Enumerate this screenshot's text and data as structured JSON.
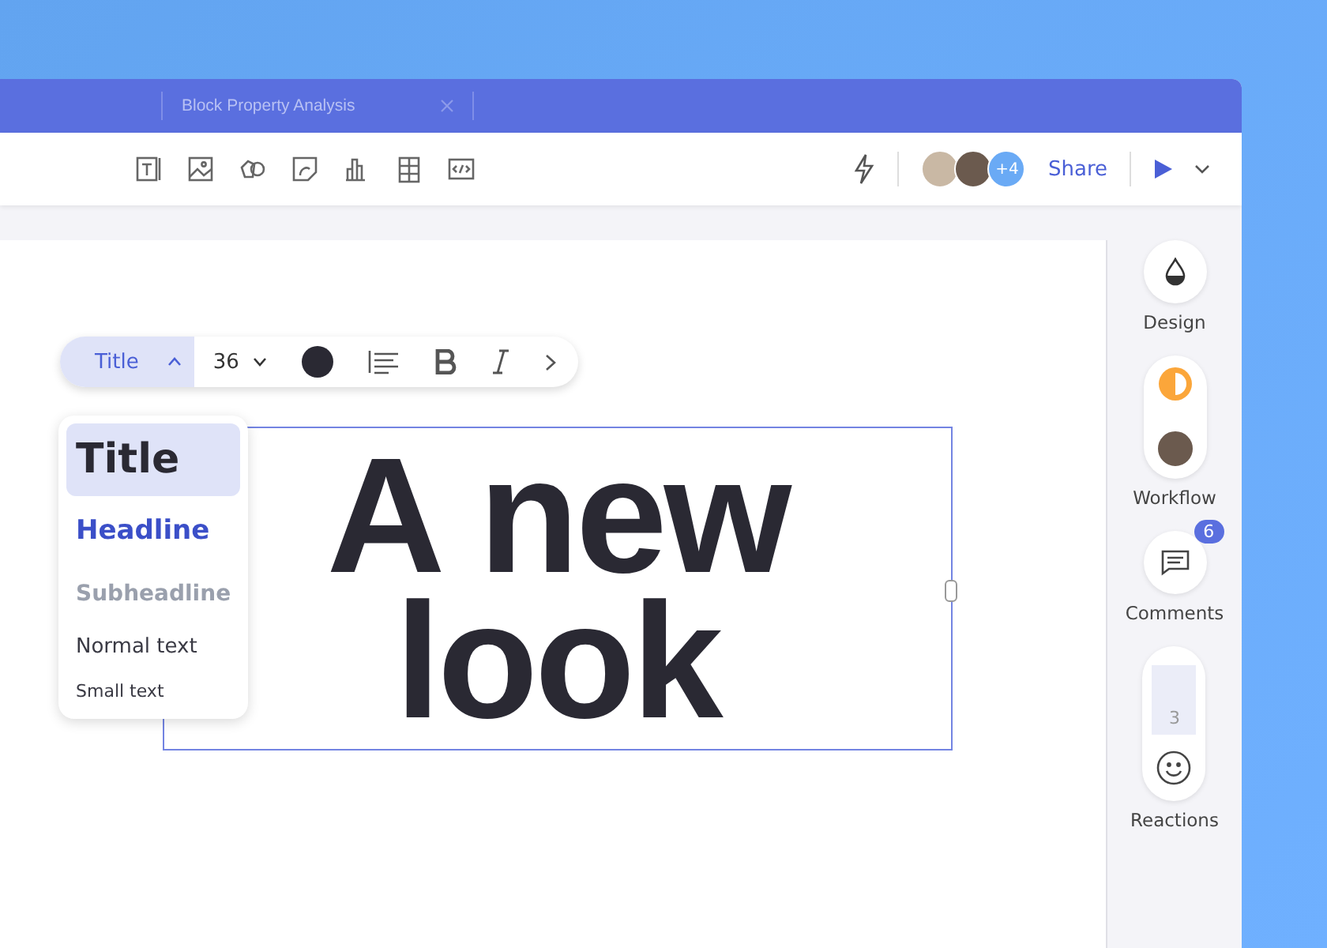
{
  "tab": {
    "title": "Block Property Analysis",
    "closable": true
  },
  "collaborators": {
    "extra_count": "+4"
  },
  "share": {
    "label": "Share"
  },
  "format_toolbar": {
    "style": "Title",
    "style_menu_expanded": true,
    "size": "36",
    "bold": false,
    "italic": false
  },
  "style_menu": [
    {
      "label": "Title",
      "kind": "title",
      "selected": true
    },
    {
      "label": "Headline",
      "kind": "headline",
      "selected": false
    },
    {
      "label": "Subheadline",
      "kind": "subheadline",
      "selected": false
    },
    {
      "label": "Normal text",
      "kind": "normal",
      "selected": false
    },
    {
      "label": "Small text",
      "kind": "small",
      "selected": false
    }
  ],
  "text_block": {
    "text": "A new look",
    "selected": true
  },
  "side_panel": [
    {
      "label": "Design",
      "kind": "design"
    },
    {
      "label": "Workflow",
      "kind": "workflow"
    },
    {
      "label": "Comments",
      "kind": "comments",
      "badge": "6"
    },
    {
      "label": "Reactions",
      "kind": "reactions",
      "count": "3"
    }
  ]
}
